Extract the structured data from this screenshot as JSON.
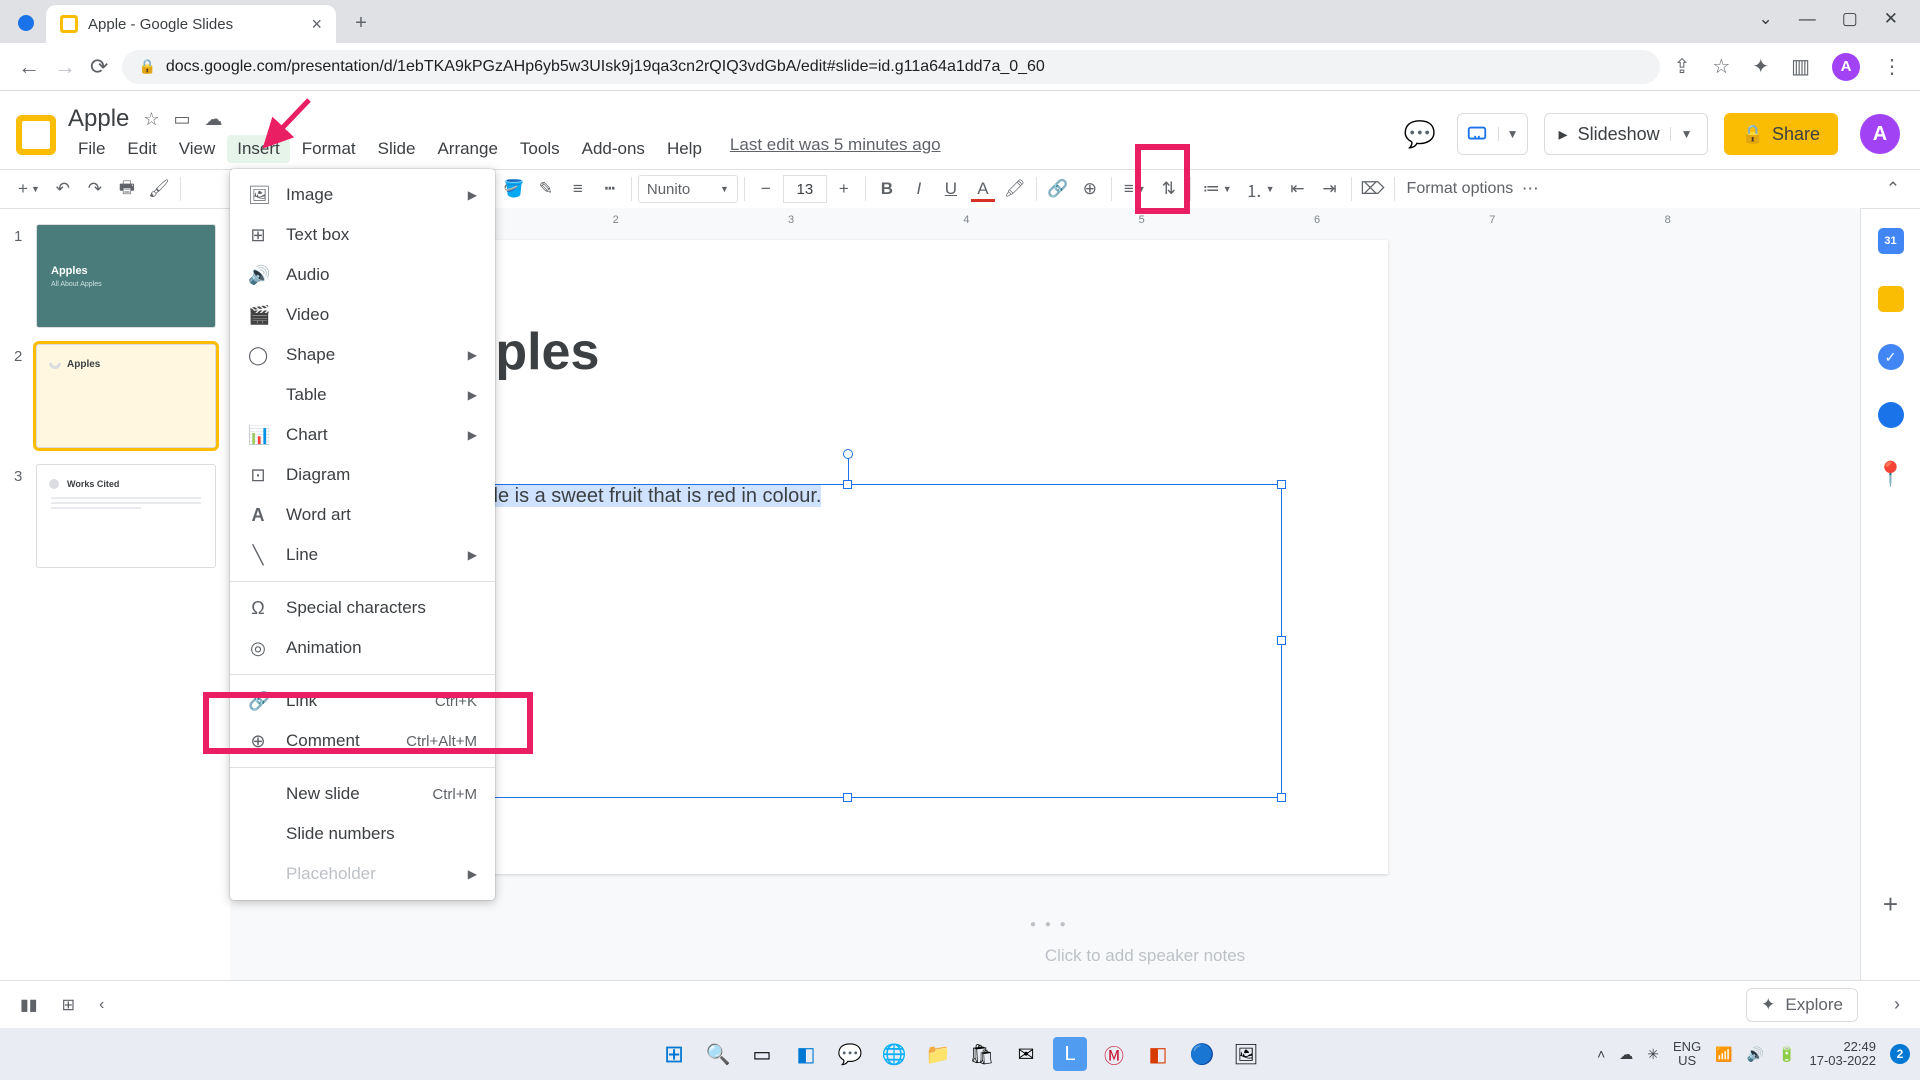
{
  "browser": {
    "tab_title": "Apple - Google Slides",
    "url": "docs.google.com/presentation/d/1ebTKA9kPGzAHp6yb5w3UIsk9j19qa3cn2rQIQ3vdGbA/edit#slide=id.g11a64a1dd7a_0_60",
    "avatar_letter": "A"
  },
  "app": {
    "doc_title": "Apple",
    "menus": [
      "File",
      "Edit",
      "View",
      "Insert",
      "Format",
      "Slide",
      "Arrange",
      "Tools",
      "Add-ons",
      "Help"
    ],
    "last_edit": "Last edit was 5 minutes ago",
    "slideshow_label": "Slideshow",
    "share_label": "Share",
    "avatar_letter": "A"
  },
  "toolbar": {
    "font": "Nunito",
    "font_size": "13",
    "format_options": "Format options"
  },
  "insert_menu": {
    "items": [
      {
        "icon": "🖼",
        "label": "Image",
        "sub": true
      },
      {
        "icon": "⊞",
        "label": "Text box"
      },
      {
        "icon": "🔊",
        "label": "Audio"
      },
      {
        "icon": "🎬",
        "label": "Video"
      },
      {
        "icon": "◯",
        "label": "Shape",
        "sub": true
      },
      {
        "icon": "",
        "label": "Table",
        "sub": true
      },
      {
        "icon": "📊",
        "label": "Chart",
        "sub": true
      },
      {
        "icon": "⊡",
        "label": "Diagram"
      },
      {
        "icon": "A",
        "label": "Word art"
      },
      {
        "icon": "╲",
        "label": "Line",
        "sub": true
      }
    ],
    "specials": [
      {
        "icon": "Ω",
        "label": "Special characters"
      },
      {
        "icon": "◎",
        "label": "Animation"
      }
    ],
    "link": {
      "icon": "🔗",
      "label": "Link",
      "kbd": "Ctrl+K"
    },
    "comment": {
      "icon": "⊕",
      "label": "Comment",
      "kbd": "Ctrl+Alt+M"
    },
    "footer": [
      {
        "label": "New slide",
        "kbd": "Ctrl+M"
      },
      {
        "label": "Slide numbers"
      },
      {
        "label": "Placeholder",
        "sub": true,
        "disabled": true
      }
    ]
  },
  "slide": {
    "title": "Apples",
    "body_text": "An Apple is a sweet fruit that is red in colour."
  },
  "thumbs": {
    "t1_title": "Apples",
    "t1_sub": "All About Apples",
    "t2_title": "Apples",
    "t3_title": "Works Cited"
  },
  "notes_placeholder": "Click to add speaker notes",
  "explore_label": "Explore",
  "taskbar": {
    "lang1": "ENG",
    "lang2": "US",
    "time": "22:49",
    "date": "17-03-2022",
    "notif": "2"
  }
}
